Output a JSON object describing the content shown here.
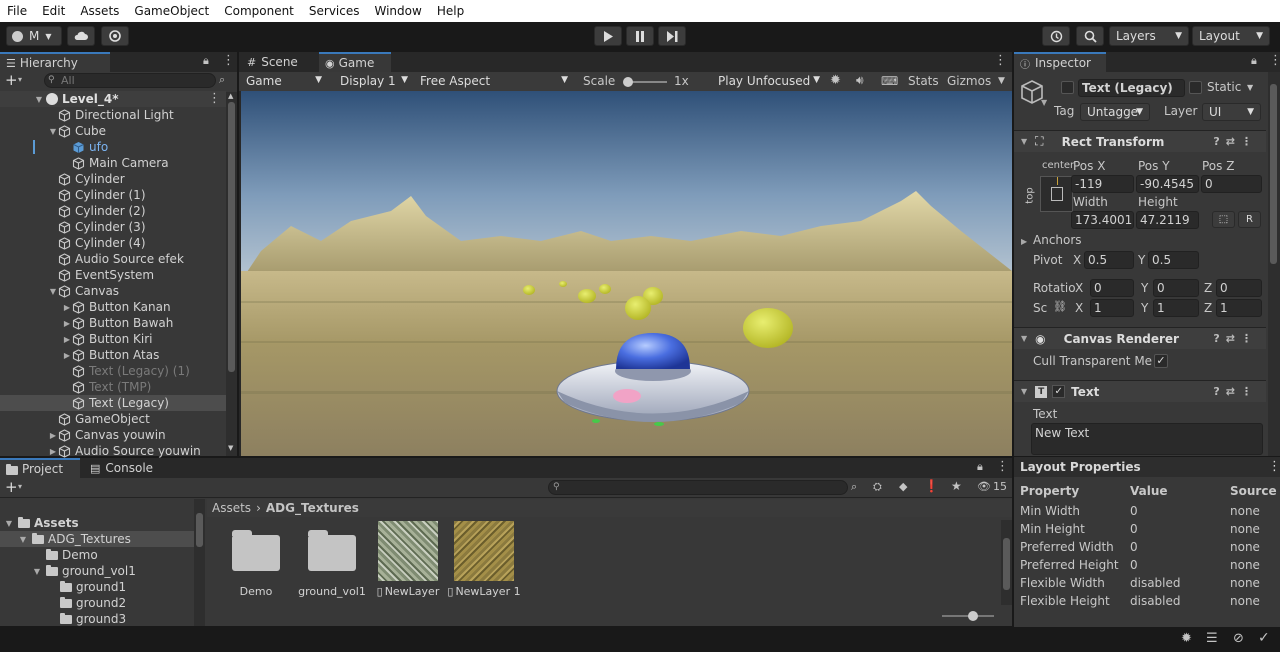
{
  "menu": [
    "File",
    "Edit",
    "Assets",
    "GameObject",
    "Component",
    "Services",
    "Window",
    "Help"
  ],
  "toolbar": {
    "account_label": "M",
    "layers_label": "Layers",
    "layout_label": "Layout"
  },
  "hierarchy": {
    "tab": "Hierarchy",
    "search_placeholder": "All",
    "scene_name": "Level_4*",
    "items": [
      {
        "label": "Directional Light",
        "indent": 1,
        "arrow": "",
        "dim": false,
        "icon": "gameobject-icon"
      },
      {
        "label": "Cube",
        "indent": 1,
        "arrow": "down",
        "dim": false,
        "icon": "gameobject-icon"
      },
      {
        "label": "ufo",
        "indent": 2,
        "arrow": "",
        "dim": false,
        "icon": "prefab-icon",
        "blue": true
      },
      {
        "label": "Main Camera",
        "indent": 2,
        "arrow": "",
        "dim": false,
        "icon": "gameobject-icon"
      },
      {
        "label": "Cylinder",
        "indent": 1,
        "arrow": "",
        "dim": false,
        "icon": "gameobject-icon"
      },
      {
        "label": "Cylinder (1)",
        "indent": 1,
        "arrow": "",
        "dim": false,
        "icon": "gameobject-icon"
      },
      {
        "label": "Cylinder (2)",
        "indent": 1,
        "arrow": "",
        "dim": false,
        "icon": "gameobject-icon"
      },
      {
        "label": "Cylinder (3)",
        "indent": 1,
        "arrow": "",
        "dim": false,
        "icon": "gameobject-icon"
      },
      {
        "label": "Cylinder (4)",
        "indent": 1,
        "arrow": "",
        "dim": false,
        "icon": "gameobject-icon"
      },
      {
        "label": "Audio Source efek",
        "indent": 1,
        "arrow": "",
        "dim": false,
        "icon": "gameobject-icon"
      },
      {
        "label": "EventSystem",
        "indent": 1,
        "arrow": "",
        "dim": false,
        "icon": "gameobject-icon"
      },
      {
        "label": "Canvas",
        "indent": 1,
        "arrow": "down",
        "dim": false,
        "icon": "gameobject-icon"
      },
      {
        "label": "Button Kanan",
        "indent": 2,
        "arrow": "right",
        "dim": false,
        "icon": "gameobject-icon"
      },
      {
        "label": "Button Bawah",
        "indent": 2,
        "arrow": "right",
        "dim": false,
        "icon": "gameobject-icon"
      },
      {
        "label": "Button Kiri",
        "indent": 2,
        "arrow": "right",
        "dim": false,
        "icon": "gameobject-icon"
      },
      {
        "label": "Button Atas",
        "indent": 2,
        "arrow": "right",
        "dim": false,
        "icon": "gameobject-icon"
      },
      {
        "label": "Text (Legacy) (1)",
        "indent": 2,
        "arrow": "",
        "dim": true,
        "icon": "gameobject-icon"
      },
      {
        "label": "Text (TMP)",
        "indent": 2,
        "arrow": "",
        "dim": true,
        "icon": "gameobject-icon"
      },
      {
        "label": "Text (Legacy)",
        "indent": 2,
        "arrow": "",
        "dim": false,
        "icon": "gameobject-icon",
        "selected": true
      },
      {
        "label": "GameObject",
        "indent": 1,
        "arrow": "",
        "dim": false,
        "icon": "gameobject-icon"
      },
      {
        "label": "Canvas youwin",
        "indent": 1,
        "arrow": "right",
        "dim": false,
        "icon": "gameobject-icon"
      },
      {
        "label": "Audio Source youwin",
        "indent": 1,
        "arrow": "right",
        "dim": false,
        "icon": "gameobject-icon"
      }
    ]
  },
  "game": {
    "tab_scene": "Scene",
    "tab_game": "Game",
    "display_mode": "Game",
    "display": "Display 1",
    "aspect": "Free Aspect",
    "scale_label": "Scale",
    "scale_value": "1x",
    "play_focus": "Play Unfocused",
    "stats": "Stats",
    "gizmos": "Gizmos"
  },
  "inspector": {
    "tab": "Inspector",
    "object_name": "Text (Legacy)",
    "static_label": "Static",
    "tag_label": "Tag",
    "tag_value": "Untagge",
    "layer_label": "Layer",
    "layer_value": "UI",
    "rect_transform": {
      "title": "Rect Transform",
      "anchor_h": "center",
      "anchor_v": "top",
      "posx_label": "Pos X",
      "posx": "-119",
      "posy_label": "Pos Y",
      "posy": "-90.4545",
      "posz_label": "Pos Z",
      "posz": "0",
      "width_label": "Width",
      "width": "173.4001",
      "height_label": "Height",
      "height": "47.2119",
      "anchors_label": "Anchors",
      "pivot_label": "Pivot",
      "pivot_x": "0.5",
      "pivot_y": "0.5",
      "rotation_label": "Rotatio",
      "rot_x": "0",
      "rot_y": "0",
      "rot_z": "0",
      "scale_label": "Sc",
      "scale_x": "1",
      "scale_y": "1",
      "scale_z": "1",
      "x": "X",
      "y": "Y",
      "z": "Z",
      "r_btn": "R"
    },
    "canvas_renderer": {
      "title": "Canvas Renderer",
      "cull_label": "Cull Transparent Me"
    },
    "text": {
      "title": "Text",
      "field_label": "Text",
      "value": "New Text"
    }
  },
  "layout_properties": {
    "title": "Layout Properties",
    "headers": [
      "Property",
      "Value",
      "Source"
    ],
    "rows": [
      [
        "Min Width",
        "0",
        "none"
      ],
      [
        "Min Height",
        "0",
        "none"
      ],
      [
        "Preferred Width",
        "0",
        "none"
      ],
      [
        "Preferred Height",
        "0",
        "none"
      ],
      [
        "Flexible Width",
        "disabled",
        "none"
      ],
      [
        "Flexible Height",
        "disabled",
        "none"
      ]
    ]
  },
  "project": {
    "tab_project": "Project",
    "tab_console": "Console",
    "hidden_count": "15",
    "breadcrumb_root": "Assets",
    "breadcrumb_current": "ADG_Textures",
    "tree": [
      {
        "label": "Assets",
        "indent": 0,
        "arrow": "down"
      },
      {
        "label": "ADG_Textures",
        "indent": 1,
        "arrow": "down",
        "selected": true
      },
      {
        "label": "Demo",
        "indent": 2,
        "arrow": ""
      },
      {
        "label": "ground_vol1",
        "indent": 2,
        "arrow": "down"
      },
      {
        "label": "ground1",
        "indent": 3,
        "arrow": ""
      },
      {
        "label": "ground2",
        "indent": 3,
        "arrow": ""
      },
      {
        "label": "ground3",
        "indent": 3,
        "arrow": ""
      }
    ],
    "assets": [
      {
        "label": "Demo",
        "kind": "folder"
      },
      {
        "label": "ground_vol1",
        "kind": "folder"
      },
      {
        "label": "NewLayer",
        "kind": "texture-green"
      },
      {
        "label": "NewLayer 1",
        "kind": "texture-brown"
      }
    ]
  }
}
